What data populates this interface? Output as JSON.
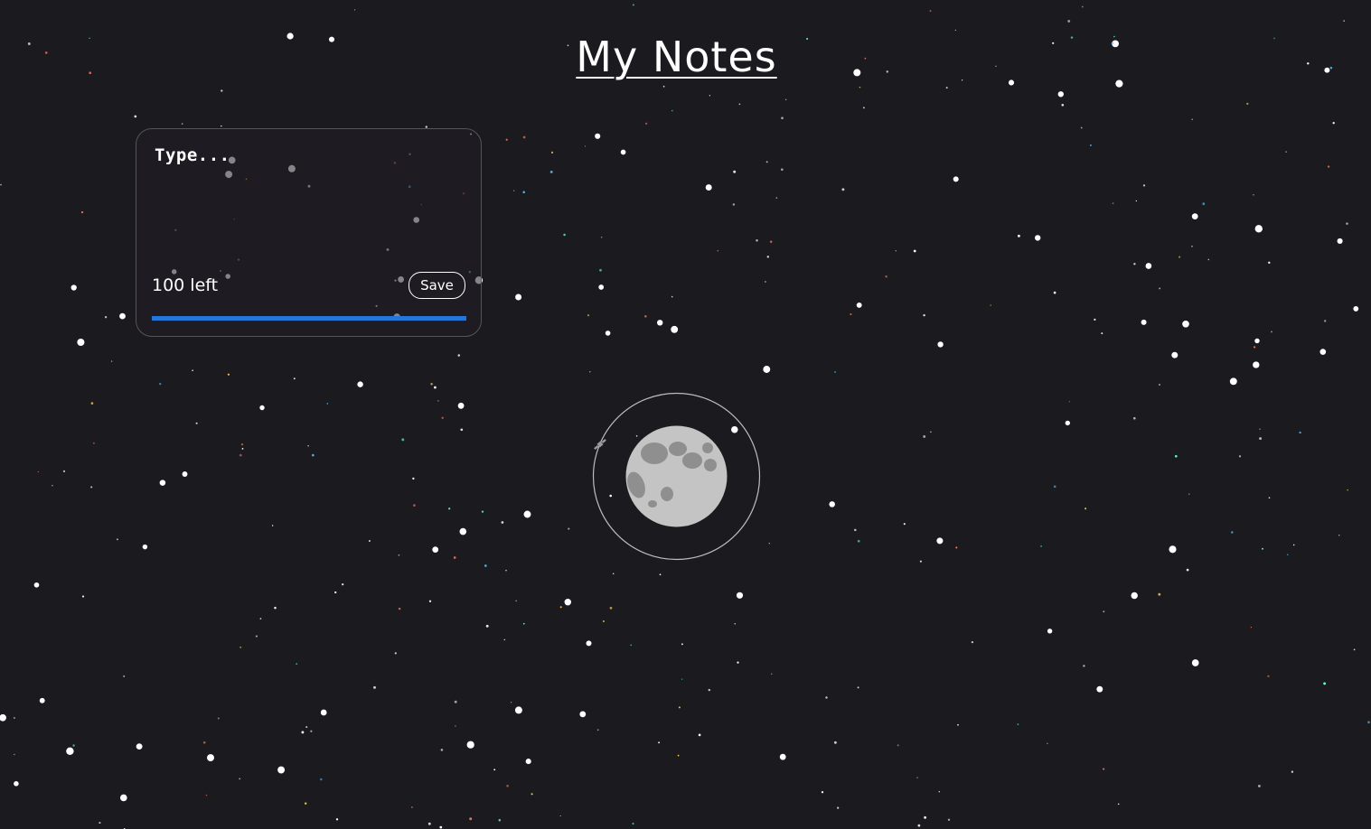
{
  "page": {
    "title": "My Notes"
  },
  "note": {
    "placeholder": "Type...",
    "value": "",
    "chars_left_label": "100 left",
    "save_label": "Save",
    "progress_fraction": 1.0
  },
  "colors": {
    "background": "#1b1a1f",
    "accent": "#2377d9",
    "moon": "#c4c4c4",
    "crater": "#8f8f8f",
    "orbit": "#d9d9d9"
  },
  "icons": {
    "moon": "moon-icon",
    "satellite": "satellite-icon"
  }
}
